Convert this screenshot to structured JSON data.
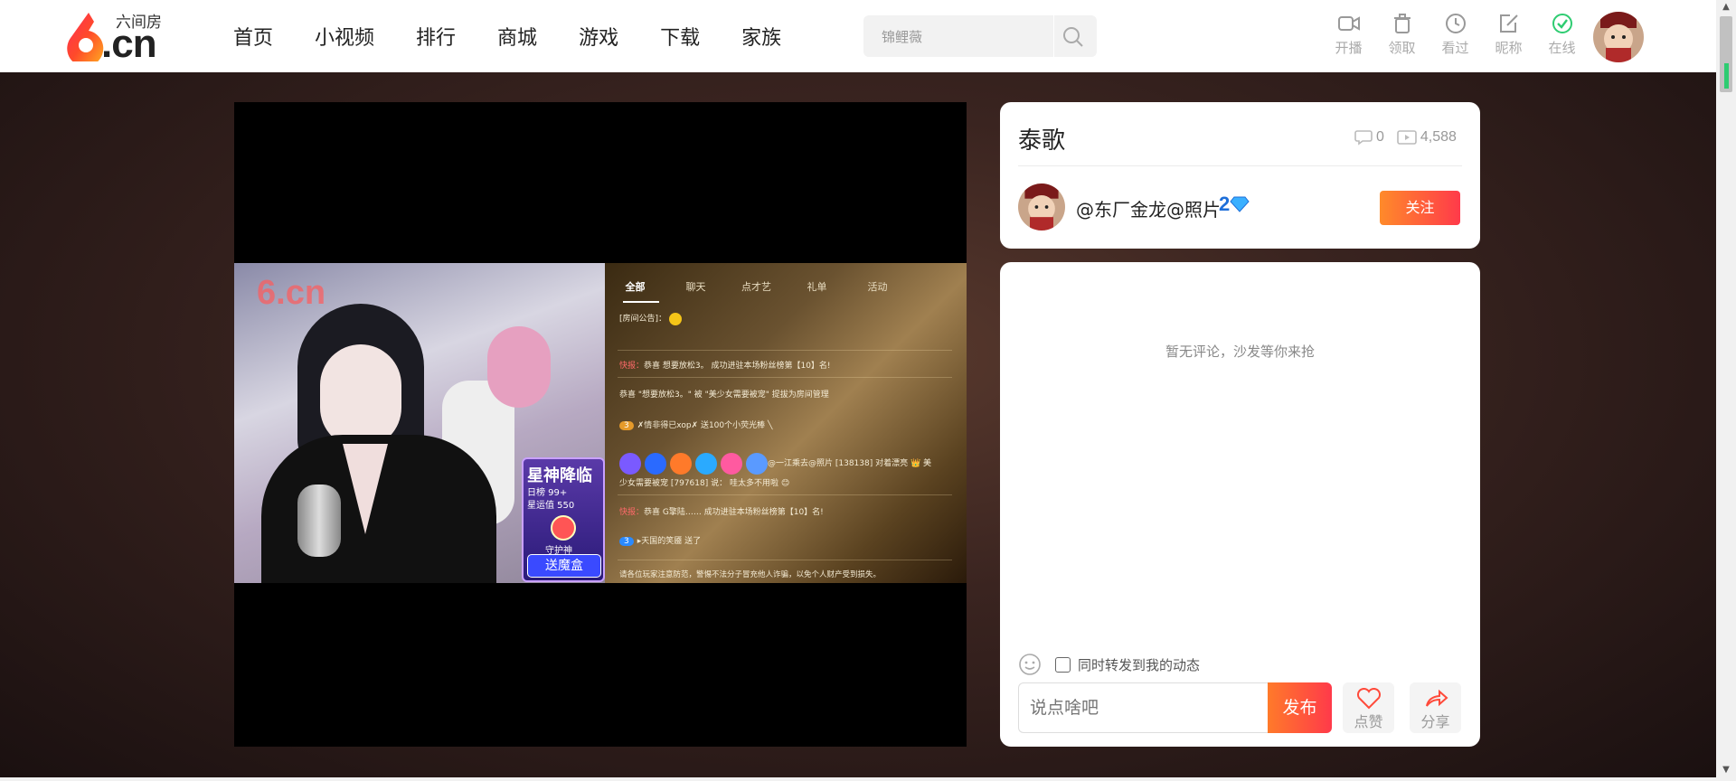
{
  "brand": {
    "name": "六间房",
    "domain": ".cn",
    "accent": "#ff4a3a"
  },
  "nav": [
    {
      "label": "首页"
    },
    {
      "label": "小视频"
    },
    {
      "label": "排行"
    },
    {
      "label": "商城"
    },
    {
      "label": "游戏"
    },
    {
      "label": "下载"
    },
    {
      "label": "家族"
    }
  ],
  "search": {
    "value": "锦鲤薇",
    "icon": "search-icon"
  },
  "header_actions": [
    {
      "label": "开播",
      "icon": "camera-icon"
    },
    {
      "label": "领取",
      "icon": "trash-icon"
    },
    {
      "label": "看过",
      "icon": "clock-icon"
    },
    {
      "label": "昵称",
      "icon": "edit-icon"
    },
    {
      "label": "在线",
      "icon": "online-check-icon"
    }
  ],
  "video": {
    "watermark": "6.cn",
    "chat_tabs": [
      "全部",
      "聊天",
      "点才艺",
      "礼单",
      "活动"
    ],
    "chat_lines": [
      {
        "prefix": "[房间公告]：",
        "text": ""
      },
      {
        "prefix": "快报：",
        "text": "恭喜 想要放松3。 成功进驻本场粉丝榜第【10】名!"
      },
      {
        "prefix": "",
        "text": "恭喜 \"想要放松3。\" 被 \"美少女需要被宠\" 提拔为房间管理"
      },
      {
        "prefix": "",
        "text": "✗情非得已xop✗ 送100个小荧光棒 ╲"
      },
      {
        "prefix": "",
        "text": "@一江乘去@照片 [138138] 对着漂亮 👑 美"
      },
      {
        "prefix": "",
        "text": "少女需要被宠 [797618] 说： 哇太多不用啦 😊"
      },
      {
        "prefix": "快报：",
        "text": "恭喜 G擎陆…… 成功进驻本场粉丝榜第【10】名!"
      },
      {
        "prefix": "",
        "text": "▸天国的笑靥 送了"
      },
      {
        "prefix": "",
        "text": "请各位玩家注意防范，警惕不法分子冒充他人诈骗，以免个人财产受到损失。"
      }
    ],
    "badge": {
      "title": "星神降临",
      "rank": "日榜 99+",
      "score": "星运值 550",
      "guard": "守护神",
      "button": "送魔盒"
    }
  },
  "info": {
    "title": "泰歌",
    "comment_count": "0",
    "view_count": "4,588",
    "author": "@东厂金龙@照片",
    "author_level": "2",
    "follow_label": "关注"
  },
  "comments": {
    "empty_text": "暂无评论，沙发等你来抢",
    "repost_label": "同时转发到我的动态",
    "input_placeholder": "说点啥吧",
    "post_label": "发布",
    "like_label": "点赞",
    "share_label": "分享"
  }
}
